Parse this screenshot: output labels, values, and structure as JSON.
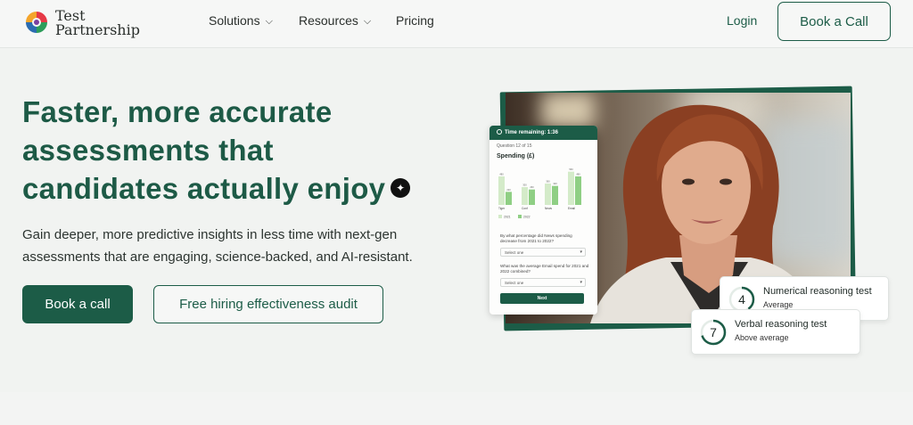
{
  "brand": {
    "name_line1": "Test",
    "name_line2": "Partnership"
  },
  "nav": {
    "items": [
      {
        "label": "Solutions",
        "has_dropdown": true
      },
      {
        "label": "Resources",
        "has_dropdown": true
      },
      {
        "label": "Pricing",
        "has_dropdown": false
      }
    ],
    "login": "Login",
    "book_call": "Book a Call"
  },
  "hero": {
    "headline_line1": "Faster, more accurate",
    "headline_line2": "assessments that",
    "headline_line3": "candidates actually enjoy",
    "subtext_line1": "Gain deeper, more predictive insights in less time with next-gen",
    "subtext_line2": "assessments that are engaging, science-backed, and AI-resistant.",
    "primary_cta": "Book a call",
    "secondary_cta": "Free hiring effectiveness audit"
  },
  "quiz": {
    "timer": "Time remaining: 1:36",
    "question_number": "Question 12 of 15",
    "title": "Spending (£)",
    "chart_data": {
      "type": "bar",
      "categories": [
        "Tiger",
        "Conf",
        "News",
        "Email"
      ],
      "series": [
        {
          "name": "2021",
          "values": [
            480,
            300,
            360,
            560
          ]
        },
        {
          "name": "2022",
          "values": [
            220,
            260,
            320,
            480
          ]
        }
      ],
      "legend": [
        "2021",
        "2022"
      ]
    },
    "question1": "By what percentage did News spending decrease from 2021 to 2022?",
    "select1": "Select one",
    "question2": "What was the average Email spend for 2021 and 2022 combined?",
    "select2": "Select one",
    "next": "Next"
  },
  "results": [
    {
      "score": "4",
      "test": "Numerical reasoning test",
      "level": "Average",
      "fraction": 0.4
    },
    {
      "score": "7",
      "test": "Verbal reasoning test",
      "level": "Above average",
      "fraction": 0.7
    }
  ],
  "colors": {
    "brand_green": "#1c5c47",
    "bar_light": "#d4ebc9",
    "bar_dark": "#8fcf84"
  }
}
